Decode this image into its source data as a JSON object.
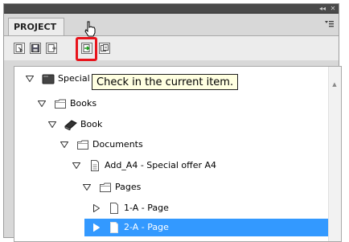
{
  "panel": {
    "title": "PROJECT",
    "topbar": {
      "collapse_glyph": "◂◂",
      "close_glyph": "✕"
    },
    "menu_icon": "panel-menu-icon"
  },
  "toolbar": {
    "tools": [
      {
        "name": "open-item-icon"
      },
      {
        "name": "save-icon"
      },
      {
        "name": "check-out-icon"
      },
      {
        "name": "check-in-icon",
        "highlighted": true
      },
      {
        "name": "refresh-icon"
      }
    ]
  },
  "tooltip": {
    "text": "Check in the current item."
  },
  "tree": {
    "rows": [
      {
        "label": "Special",
        "icon": "folder-dark-icon",
        "twisty": "expanded",
        "level": 0
      },
      {
        "label": "Books",
        "icon": "folder-icon",
        "twisty": "expanded",
        "level": 1
      },
      {
        "label": "Book",
        "icon": "book-icon",
        "twisty": "expanded",
        "level": 2
      },
      {
        "label": "Documents",
        "icon": "folder-icon",
        "twisty": "expanded",
        "level": 3
      },
      {
        "label": "Add_A4 - Special offer A4",
        "icon": "document-icon",
        "twisty": "expanded",
        "level": 4
      },
      {
        "label": "Pages",
        "icon": "folder-icon",
        "twisty": "expanded",
        "level": 5
      },
      {
        "label": "1-A - Page",
        "icon": "page-icon",
        "twisty": "collapsed",
        "level": 6
      },
      {
        "label": "2-A - Page",
        "icon": "page-icon",
        "twisty": "collapsed",
        "level": 6,
        "selected": true
      }
    ]
  },
  "colors": {
    "selection": "#3399ff",
    "highlight": "#e8141c",
    "tooltip_bg": "#ffffe1"
  }
}
